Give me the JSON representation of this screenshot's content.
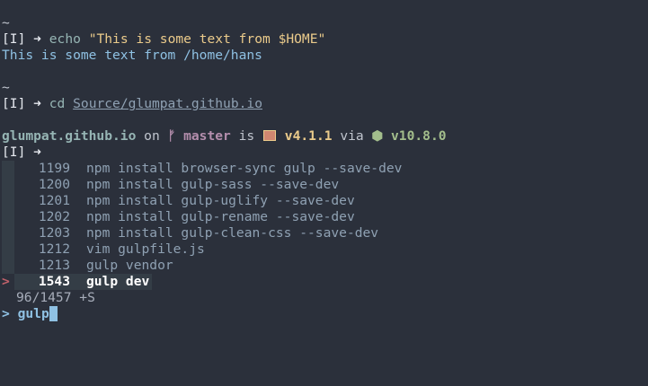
{
  "terminal": {
    "block1": {
      "cwd": "~",
      "mode": "[I]",
      "arrow": "➜",
      "cmd": "echo",
      "arg": "\"This is some text from $HOME\"",
      "output": "This is some text from /home/hans"
    },
    "block2": {
      "cwd": "~",
      "mode": "[I]",
      "arrow": "➜",
      "cmd": "cd",
      "arg": "Source/glumpat.github.io"
    },
    "block3": {
      "dir": "glumpat.github.io",
      "on": "on",
      "branch_icon": "ᚠ",
      "branch": "master",
      "is": "is",
      "pkg_version": "v4.1.1",
      "via": "via",
      "node_icon": "⬢",
      "node_version": "v10.8.0",
      "mode": "[I]",
      "arrow": "➜"
    },
    "history": [
      {
        "num": "1199",
        "cmd": "npm install browser-sync gulp --save-dev",
        "selected": false
      },
      {
        "num": "1200",
        "cmd": "npm install gulp-sass --save-dev",
        "selected": false
      },
      {
        "num": "1201",
        "cmd": "npm install gulp-uglify --save-dev",
        "selected": false
      },
      {
        "num": "1202",
        "cmd": "npm install gulp-rename --save-dev",
        "selected": false
      },
      {
        "num": "1203",
        "cmd": "npm install gulp-clean-css --save-dev",
        "selected": false
      },
      {
        "num": "1212",
        "cmd": "vim gulpfile.js",
        "selected": false
      },
      {
        "num": "1213",
        "cmd": "gulp vendor",
        "selected": false
      },
      {
        "num": "1543",
        "cmd": "gulp dev",
        "selected": true
      }
    ],
    "selected_marker": ">",
    "counter": "96/1457 +S",
    "query_prompt": ">",
    "query": "gulp"
  },
  "colors": {
    "background": "#2b303b",
    "foreground": "#c0c5ce",
    "accent_blue": "#8fc1e3",
    "yellow": "#ebcb8b",
    "magenta": "#b48ead",
    "green": "#a3be8c",
    "red": "#bf616a"
  }
}
